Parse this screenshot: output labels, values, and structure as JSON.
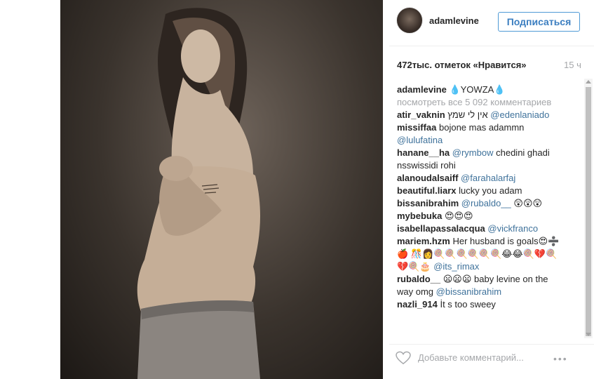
{
  "post": {
    "username": "adamlevine",
    "follow_label": "Подписаться",
    "likes": "472тыс. отметок «Нравится»",
    "time": "15 ч"
  },
  "comments": {
    "caption_user": "adamlevine",
    "caption_text": "💧YOWZA💧",
    "view_all": "посмотреть все 5 092 комментариев",
    "items": [
      {
        "user": "atir_vaknin",
        "text": "אין לי שמץ",
        "mention": "@edenlaniado"
      },
      {
        "user": "missiffaa",
        "text": "bojone mas adammn",
        "mention": "@lulufatina"
      },
      {
        "user": "hanane__ha",
        "mention": "@rymbow",
        "text": "chedini ghadi nsswissidi rohi"
      },
      {
        "user": "alanoudalsaiff",
        "mention": "@farahalarfaj"
      },
      {
        "user": "beautiful.liarx",
        "text": "lucky you adam"
      },
      {
        "user": "bissanibrahim",
        "mention": "@rubaldo__",
        "text": "😲😲😲"
      },
      {
        "user": "mybebuka",
        "text": "😍😍😍"
      },
      {
        "user": "isabellapassalacqua",
        "mention": "@vickfranco"
      },
      {
        "user": "mariem.hzm",
        "text": "Her husband is goals😍➗🍎 🎊👩🍭🍭🍭🍭🍭🍭😂😂🍭💔🍭💔🍭🎂",
        "mention": "@its_rimax"
      },
      {
        "user": "rubaldo__",
        "text": "😦😦😦 baby levine on the way omg",
        "mention": "@bissanibrahim"
      },
      {
        "user": "nazli_914",
        "text": "İt s too sweey"
      }
    ]
  },
  "footer": {
    "add_comment_placeholder": "Добавьте комментарий...",
    "more": "•••"
  },
  "icons": {
    "heart": "heart-outline-icon",
    "more": "more-options-icon",
    "avatar": "profile-avatar"
  }
}
